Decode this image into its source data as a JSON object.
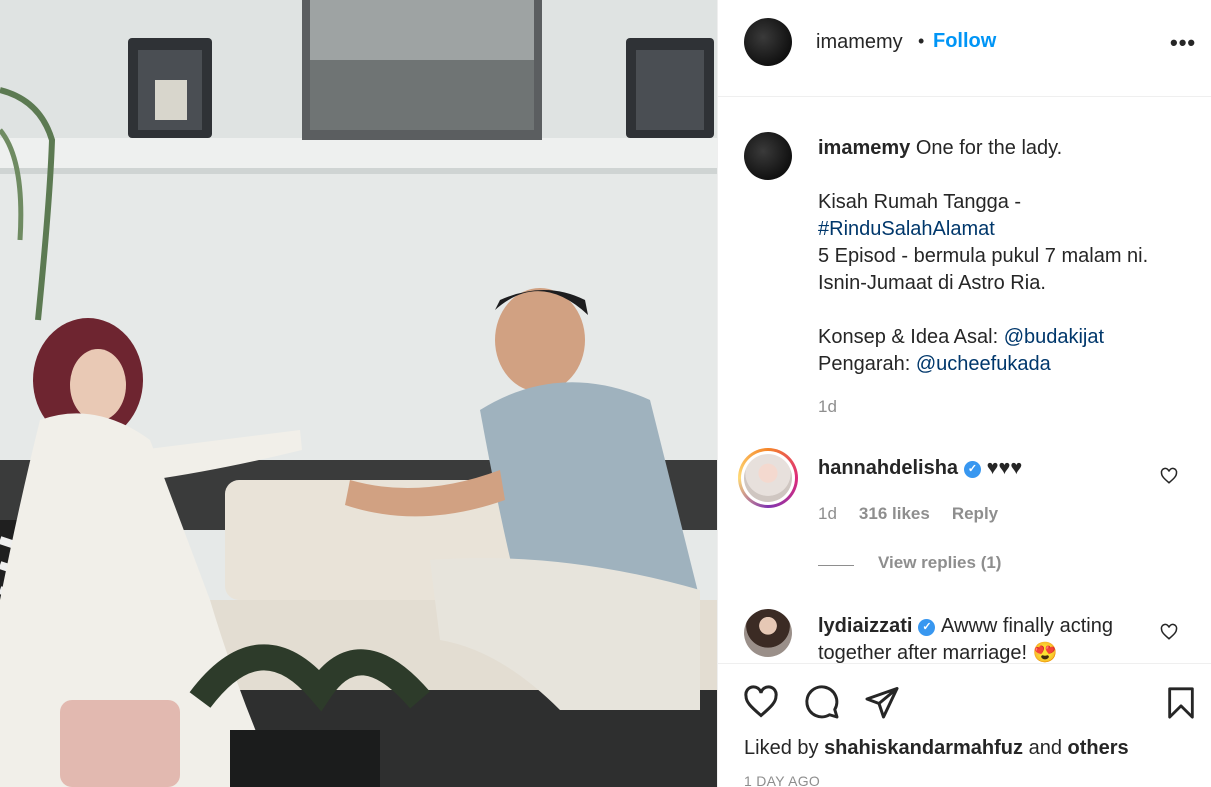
{
  "post": {
    "username": "imamemy",
    "separator": "•",
    "follow_label": "Follow",
    "more_label": "•••"
  },
  "caption": {
    "username": "imamemy",
    "text": "One for the lady.",
    "line2": "Kisah Rumah Tangga -",
    "hashtag": "#RinduSalahAlamat",
    "line4": "5 Episod - bermula pukul 7 malam ni.",
    "line5": "Isnin-Jumaat di Astro Ria.",
    "line6_prefix": "Konsep & Idea Asal: ",
    "line6_mention": "@budakijat",
    "line7_prefix": "Pengarah: ",
    "line7_mention": "@ucheefukada",
    "time": "1d"
  },
  "comments": [
    {
      "username": "hannahdelisha",
      "verified": "✓",
      "text": "♥♥♥",
      "time": "1d",
      "likes": "316 likes",
      "reply_label": "Reply",
      "view_replies": "View replies (1)"
    },
    {
      "username": "lydiaizzati",
      "verified": "✓",
      "text": "Awww finally acting",
      "text2": "together after marriage! 😍"
    }
  ],
  "footer": {
    "liked_by_prefix": "Liked by ",
    "liked_by_user": "shahiskandarmahfuz",
    "liked_by_and": " and ",
    "liked_by_others": "others",
    "timestamp": "1 DAY AGO"
  },
  "icons": {
    "like": "heart-icon",
    "comment": "comment-icon",
    "share": "share-icon",
    "save": "bookmark-icon",
    "more": "more-icon"
  },
  "colors": {
    "link_blue": "#0095f6",
    "mention_blue": "#00376b",
    "muted": "#8e8e8e",
    "text": "#262626"
  }
}
